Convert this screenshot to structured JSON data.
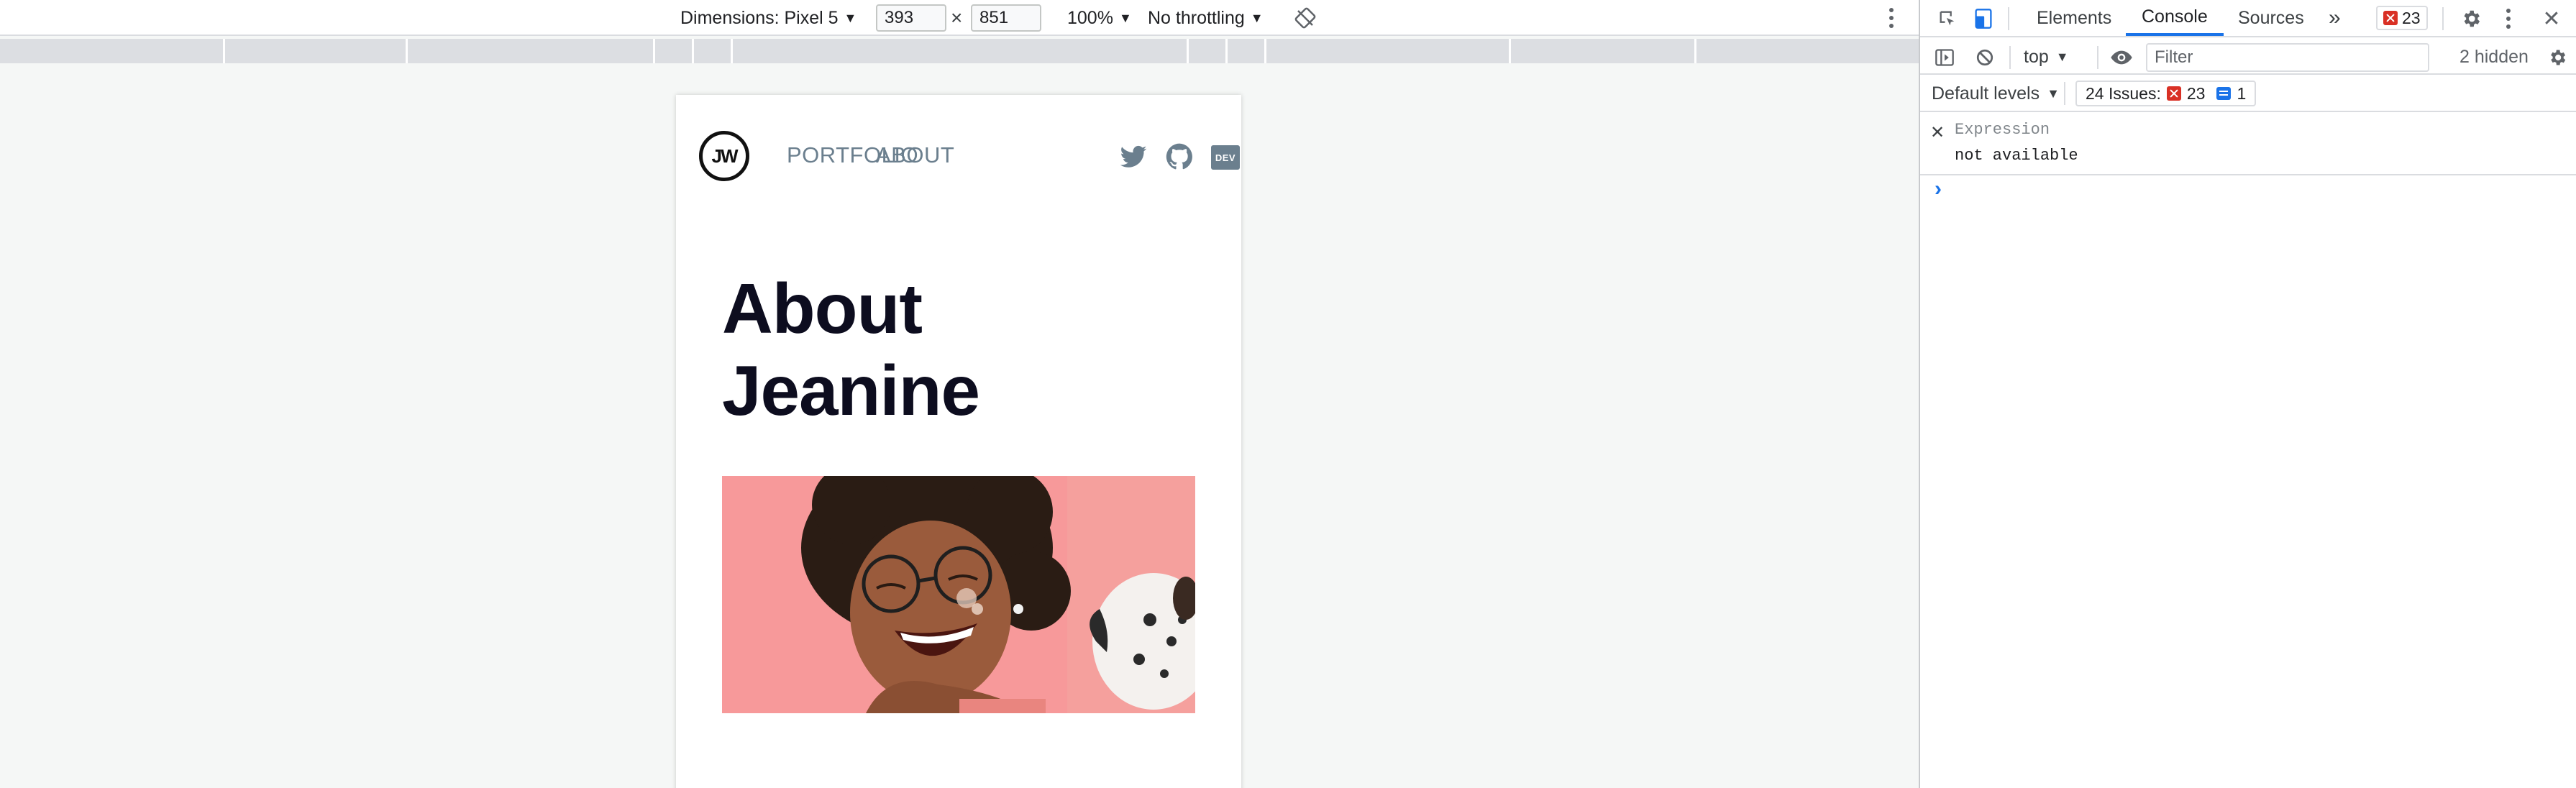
{
  "device_toolbar": {
    "dimensions_label": "Dimensions: Pixel 5",
    "width_value": "393",
    "times_sign": "×",
    "height_value": "851",
    "zoom_label": "100%",
    "throttling_label": "No throttling",
    "caret": "▼"
  },
  "site": {
    "logo_text": "JW",
    "nav": [
      "PORTFOLIO",
      "ABOUT"
    ],
    "social_icons": [
      "twitter-icon",
      "github-icon",
      "dev-icon"
    ],
    "dev_badge": "DEV",
    "title_line1": "About",
    "title_line2": "Jeanine",
    "colors": {
      "nav_link": "#6b7f8e",
      "title": "#0d0d1f",
      "photo_bg": "#f7999a"
    }
  },
  "devtools": {
    "tabs": [
      "Elements",
      "Console",
      "Sources"
    ],
    "active_tab": "Console",
    "more_tabs": "»",
    "error_count": "23",
    "context": "top",
    "filter_placeholder": "Filter",
    "hidden_label": "2 hidden",
    "levels_label": "Default levels",
    "issues_label": "24 Issues:",
    "issues_errors": "23",
    "issues_info": "1",
    "expression_label": "Expression",
    "expression_value": "not available",
    "prompt_glyph": "›",
    "close_glyph": "✕",
    "colors": {
      "accent": "#1a73e8",
      "error": "#d93025"
    }
  }
}
